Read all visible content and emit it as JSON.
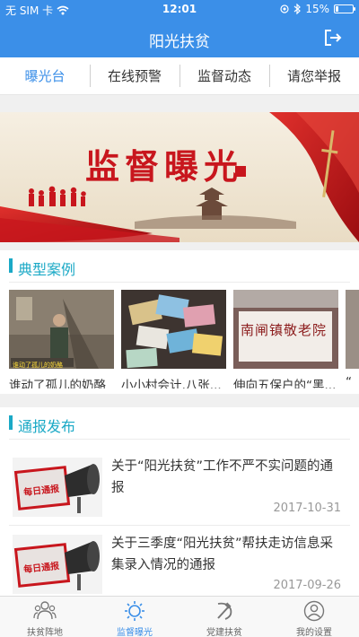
{
  "status_bar": {
    "carrier": "无 SIM 卡",
    "time": "12:01",
    "battery": "15%",
    "battery_level": 0.15,
    "icons": [
      "wifi-icon",
      "location-icon",
      "bluetooth-icon",
      "battery-icon"
    ]
  },
  "header": {
    "title": "阳光扶贫",
    "logout_icon": "logout-icon",
    "background": "#3b8fe8"
  },
  "tabs": [
    {
      "label": "曝光台",
      "active": true
    },
    {
      "label": "在线预警",
      "active": false
    },
    {
      "label": "监督动态",
      "active": false
    },
    {
      "label": "请您举报",
      "active": false
    }
  ],
  "banner": {
    "headline": "监督曝光"
  },
  "cases": {
    "title": "典型案例",
    "items": [
      {
        "caption": "谁动了孤儿的奶酪",
        "overlay": "谁动了孤儿的奶酪"
      },
      {
        "caption": "小小村会计,八张..."
      },
      {
        "caption": "伸向五保户的“黑...",
        "overlay": "南闸镇敬老院"
      },
      {
        "caption": "“"
      }
    ]
  },
  "notices": {
    "title": "通报发布",
    "items": [
      {
        "title": "关于“阳光扶贫”工作不严不实问题的通报",
        "date": "2017-10-31",
        "thumb_text": "每日通报"
      },
      {
        "title": "关于三季度“阳光扶贫”帮扶走访信息采集录入情况的通报",
        "date": "2017-09-26",
        "thumb_text": "每日通报"
      }
    ]
  },
  "tabbar": [
    {
      "label": "扶贫阵地",
      "icon": "people-icon",
      "active": false
    },
    {
      "label": "监督曝光",
      "icon": "sun-icon",
      "active": true
    },
    {
      "label": "党建扶贫",
      "icon": "hammer-sickle-icon",
      "active": false
    },
    {
      "label": "我的设置",
      "icon": "user-icon",
      "active": false
    }
  ],
  "colors": {
    "accent": "#3b8fe8",
    "section": "#1ba9c6",
    "banner_red": "#c8161d"
  }
}
